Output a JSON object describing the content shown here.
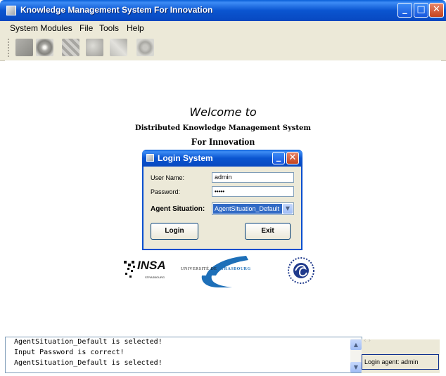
{
  "window": {
    "title": "Knowledge Management System For Innovation"
  },
  "menu": {
    "items": [
      "System Modules",
      "File",
      "Tools",
      "Help"
    ]
  },
  "toolbar": {
    "icons": [
      "agent-icon",
      "eye-icon",
      "grid-icon",
      "network-icon",
      "tree-icon",
      "gear-icon"
    ]
  },
  "welcome": {
    "line1": "Welcome to",
    "line2": "Distributed Knowledge Management System",
    "line3": "For Innovation"
  },
  "login": {
    "title": "Login System",
    "username_label": "User Name:",
    "username_value": "admin",
    "password_label": "Password:",
    "password_value": "•••••",
    "agent_label": "Agent Situation:",
    "agent_value": "AgentSituation_Default",
    "login_button": "Login",
    "exit_button": "Exit"
  },
  "logos": {
    "insa": "INSA",
    "insa_sub": "STRASBOURG",
    "univ_prefix": "UNIVERSITÉ DE",
    "univ_name": "STRASBOURG"
  },
  "console": {
    "lines": [
      "AgentSituation_Default is selected!",
      "Input Password is correct!",
      "AgentSituation_Default is selected!"
    ]
  },
  "status": {
    "text": "Login agent: admin"
  },
  "colors": {
    "accent": "#0a55d0",
    "selection": "#316ac5"
  }
}
